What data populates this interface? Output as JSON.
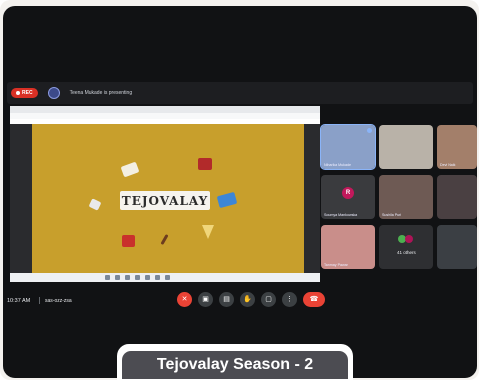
{
  "meeting": {
    "rec_label": "REC",
    "presenting_text": "Teena Mukade is presenting",
    "clock": "10:37 AM",
    "meeting_code": "sas-ozz-zsa"
  },
  "slide": {
    "logo_text": "TEJOVALAY"
  },
  "participants": [
    {
      "name": "Niharika Mukade"
    },
    {
      "name": ""
    },
    {
      "name": "Devi Naik"
    },
    {
      "name": "Soumya Mankowska",
      "initial": "R"
    },
    {
      "name": "Sushila Puri"
    },
    {
      "name": ""
    },
    {
      "name": "Tanmay Pawar"
    },
    {
      "name": ""
    },
    {
      "name": ""
    }
  ],
  "others": {
    "label": "41 others"
  },
  "controls": {
    "mic": "mic-off-icon",
    "camera": "camera-icon",
    "captions": "captions-icon",
    "hand": "raise-hand-icon",
    "present": "present-screen-icon",
    "more": "more-options-icon",
    "end": "end-call-icon"
  },
  "caption": {
    "text": "Tejovalay Season - 2"
  },
  "colors": {
    "slide_bg": "#c89f2c",
    "caption_bg": "#4c4c52",
    "accent_red": "#ea4335",
    "meet_bg": "#111214"
  }
}
